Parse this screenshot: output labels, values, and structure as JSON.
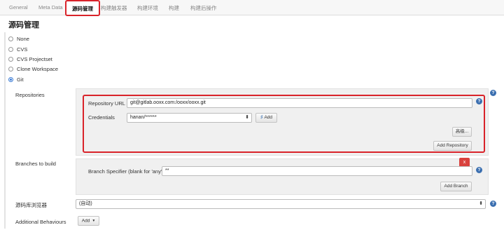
{
  "tabs": [
    "General",
    "Meta Data",
    "源码管理",
    "构建触发器",
    "构建环境",
    "构建",
    "构建后操作"
  ],
  "section_title": "源码管理",
  "scm_options": [
    {
      "label": "None",
      "checked": false
    },
    {
      "label": "CVS",
      "checked": false
    },
    {
      "label": "CVS Projectset",
      "checked": false
    },
    {
      "label": "Clone Workspace",
      "checked": false
    },
    {
      "label": "Git",
      "checked": true
    }
  ],
  "repositories": {
    "label": "Repositories",
    "url_label": "Repository URL",
    "url_value": "git@gitlab.ooxx.com:/ooxx/ooxx.git",
    "credentials_label": "Credentials",
    "credentials_value": "hanan/******",
    "add_credentials_button": "Add",
    "advanced_button": "高级...",
    "add_repository_button": "Add Repository"
  },
  "branches": {
    "label": "Branches to build",
    "delete_button": "x",
    "specifier_label": "Branch Specifier (blank for 'any')",
    "specifier_value": "**",
    "add_branch_button": "Add Branch"
  },
  "repo_browser": {
    "label": "源码库浏览器",
    "value": "(自动)"
  },
  "additional_behaviours": {
    "label": "Additional Behaviours",
    "add_button": "Add"
  },
  "icons": {
    "help": "help-icon",
    "key": "key-icon",
    "caret": "caret-down-icon",
    "select": "select-arrows-icon"
  }
}
